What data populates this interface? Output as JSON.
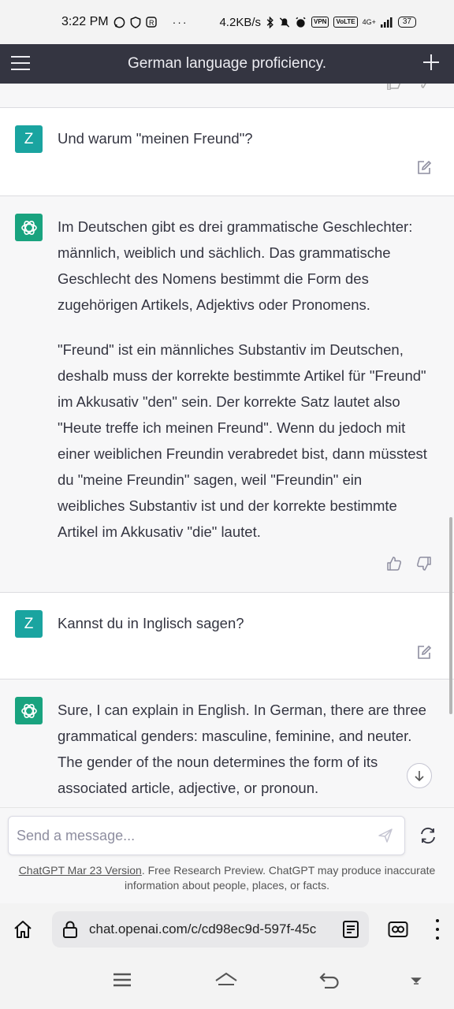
{
  "status_bar": {
    "time": "3:22 PM",
    "dots": "···",
    "speed": "4.2KB/s",
    "vpn": "VPN",
    "volte": "VoLTE",
    "network": "4G+",
    "battery": "37"
  },
  "header": {
    "title": "German language proficiency."
  },
  "messages": [
    {
      "role": "user",
      "avatar": "Z",
      "text": "Und warum \"meinen Freund\"?"
    },
    {
      "role": "assistant",
      "paragraphs": [
        "Im Deutschen gibt es drei grammatische Geschlechter: männlich, weiblich und sächlich. Das grammatische Geschlecht des Nomens bestimmt die Form des zugehörigen Artikels, Adjektivs oder Pronomens.",
        "\"Freund\" ist ein männliches Substantiv im Deutschen, deshalb muss der korrekte bestimmte Artikel für \"Freund\" im Akkusativ \"den\" sein. Der korrekte Satz lautet also \"Heute treffe ich meinen Freund\". Wenn du jedoch mit einer weiblichen Freundin verabredet bist, dann müsstest du \"meine Freundin\" sagen, weil \"Freundin\" ein weibliches Substantiv ist und der korrekte bestimmte Artikel im Akkusativ \"die\" lautet."
      ]
    },
    {
      "role": "user",
      "avatar": "Z",
      "text": "Kannst du in Inglisch sagen?"
    },
    {
      "role": "assistant",
      "paragraphs": [
        "Sure, I can explain in English. In German, there are three grammatical genders: masculine, feminine, and neuter. The gender of the noun determines the form of its associated article, adjective, or pronoun."
      ]
    }
  ],
  "composer": {
    "placeholder": "Send a message...",
    "disclaimer_link": "ChatGPT Mar 23 Version",
    "disclaimer_text": ". Free Research Preview. ChatGPT may produce inaccurate information about people, places, or facts."
  },
  "browser": {
    "url": "chat.openai.com/c/cd98ec9d-597f-45c"
  },
  "icons": {
    "menu": "hamburger-icon",
    "new_chat": "plus-icon",
    "edit": "edit-icon",
    "thumbs_up": "thumbs-up-icon",
    "thumbs_down": "thumbs-down-icon",
    "send": "send-icon",
    "regenerate": "regenerate-icon",
    "scroll_down": "arrow-down-icon"
  },
  "colors": {
    "header_bg": "#343541",
    "user_avatar": "#1aa4a0",
    "bot_avatar": "#19a37f"
  }
}
